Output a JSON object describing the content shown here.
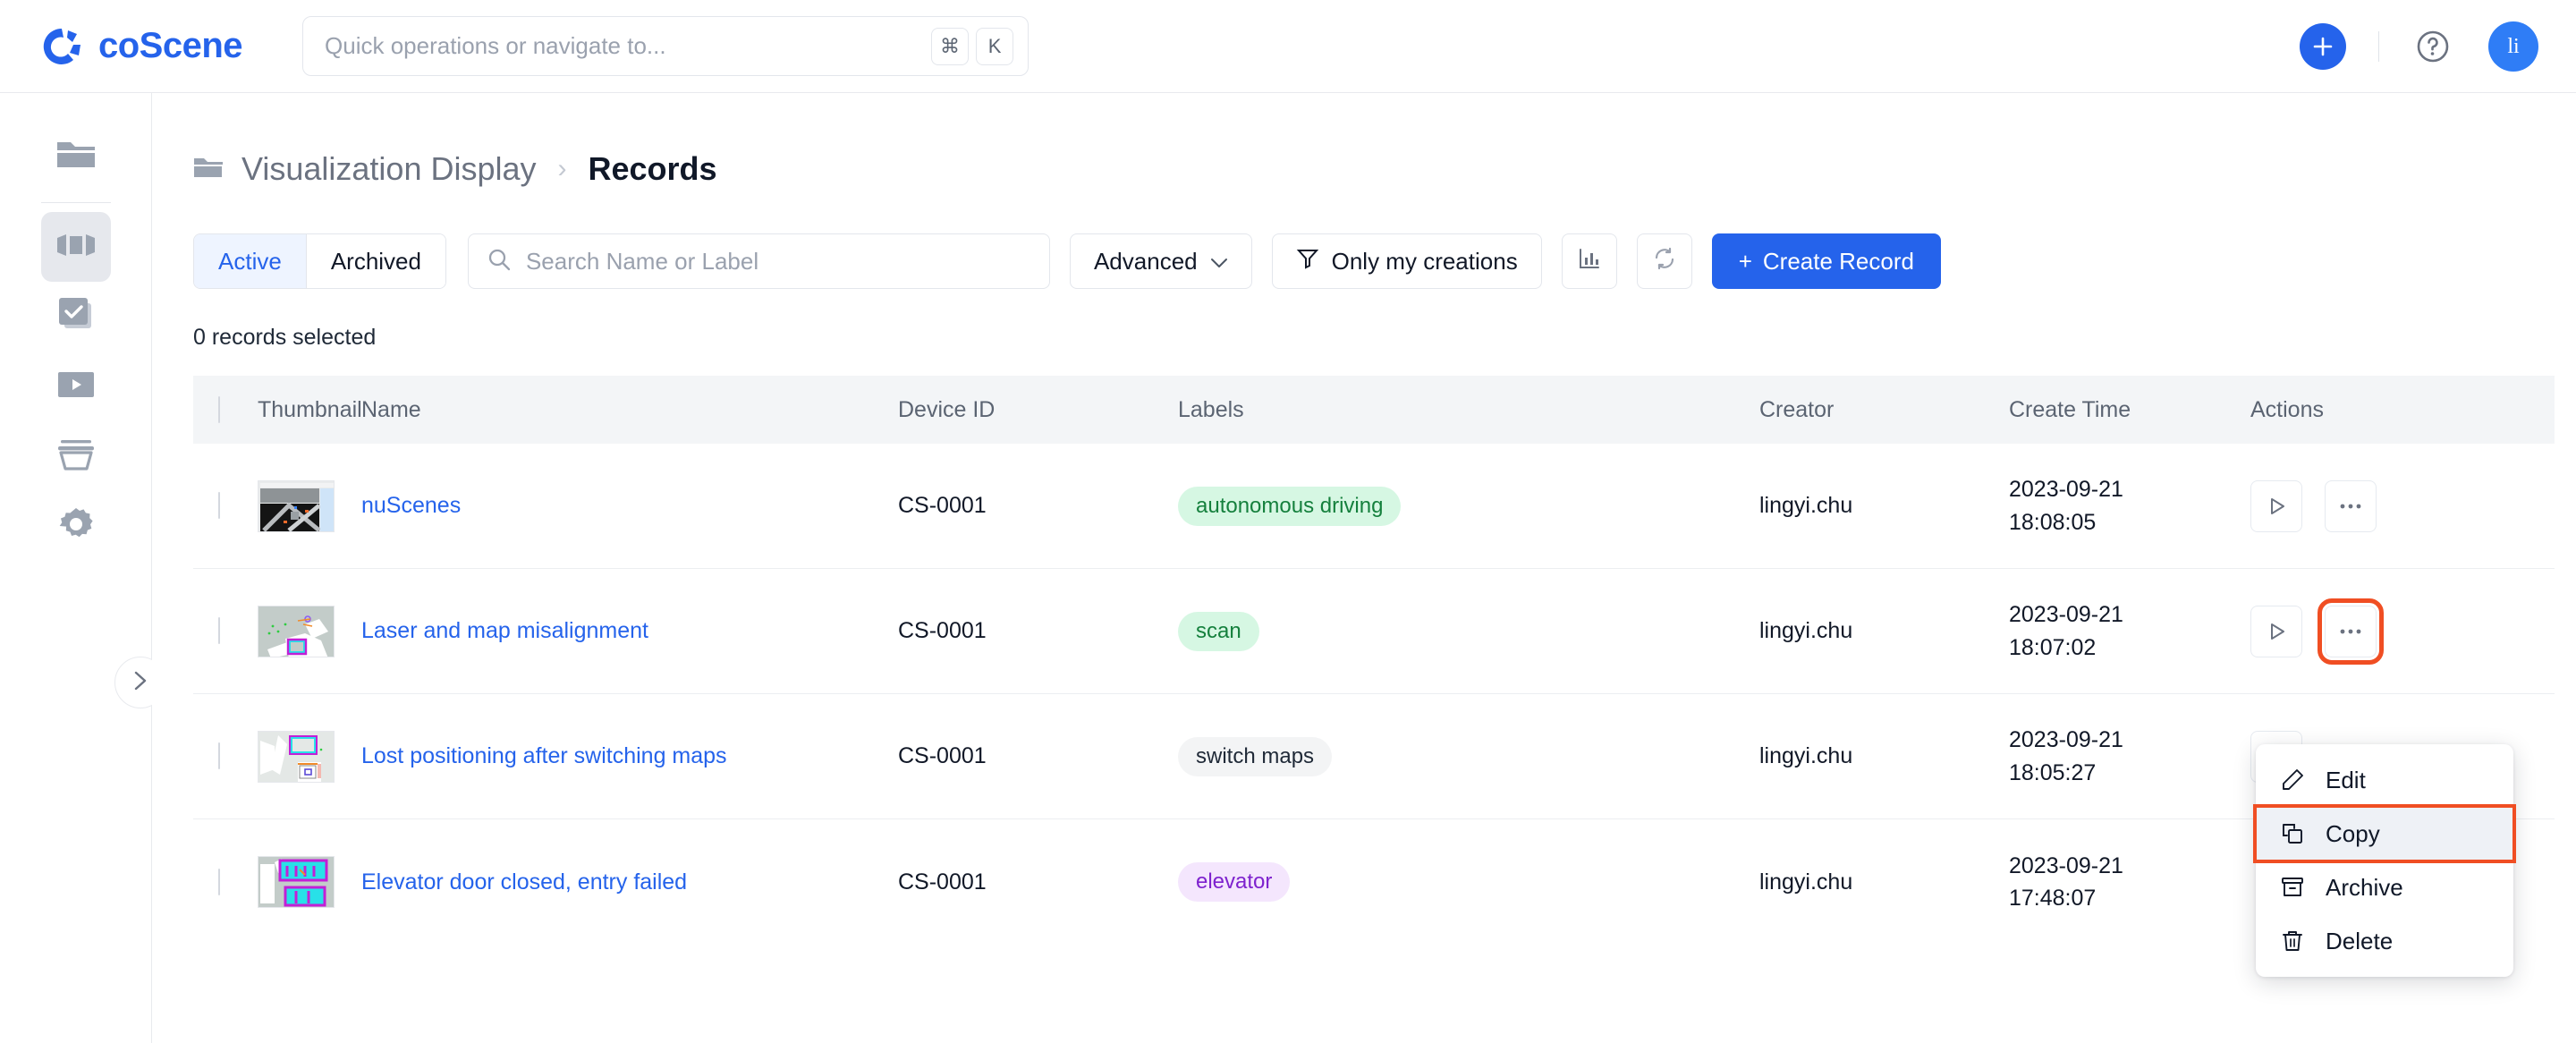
{
  "brand": {
    "name": "coScene"
  },
  "omnibox": {
    "placeholder": "Quick operations or navigate to...",
    "key1": "⌘",
    "key2": "K"
  },
  "topbar": {
    "add_label": "+",
    "avatar_initials": "li"
  },
  "breadcrumb": {
    "parent": "Visualization Display",
    "separator": "›",
    "current": "Records"
  },
  "toolbar": {
    "tab_active": "Active",
    "tab_archived": "Archived",
    "search_placeholder": "Search Name or Label",
    "advanced": "Advanced",
    "advanced_caret": "∨",
    "only_my_creations": "Only my creations",
    "create_record": "Create Record",
    "create_plus": "+"
  },
  "selection": {
    "count_text": "0 records selected"
  },
  "table": {
    "columns": [
      "Thumbnail",
      "Name",
      "Device ID",
      "Labels",
      "Creator",
      "Create Time",
      "Actions"
    ],
    "rows": [
      {
        "name": "nuScenes",
        "device_id": "CS-0001",
        "label": "autonomous driving",
        "label_color": "green",
        "creator": "lingyi.chu",
        "date": "2023-09-21",
        "time": "18:08:05",
        "thumb": "nuscenes"
      },
      {
        "name": "Laser and map misalignment",
        "device_id": "CS-0001",
        "label": "scan",
        "label_color": "green",
        "creator": "lingyi.chu",
        "date": "2023-09-21",
        "time": "18:07:02",
        "thumb": "map-scan"
      },
      {
        "name": "Lost positioning after switching maps",
        "device_id": "CS-0001",
        "label": "switch maps",
        "label_color": "gray",
        "creator": "lingyi.chu",
        "date": "2023-09-21",
        "time": "18:05:27",
        "thumb": "map-switch"
      },
      {
        "name": "Elevator door closed, entry failed",
        "device_id": "CS-0001",
        "label": "elevator",
        "label_color": "purple",
        "creator": "lingyi.chu",
        "date": "2023-09-21",
        "time": "17:48:07",
        "thumb": "map-elevator"
      }
    ]
  },
  "context_menu": {
    "items": [
      "Edit",
      "Copy",
      "Archive",
      "Delete"
    ],
    "selected": "Copy"
  },
  "colors": {
    "brand_blue": "#2563eb",
    "link_blue": "#2563eb",
    "highlight_orange": "#f04e23",
    "badge_green_bg": "#d6f7e3",
    "badge_green_fg": "#15803d",
    "badge_gray_bg": "#f3f4f5",
    "badge_purple_bg": "#f4e6fd",
    "badge_purple_fg": "#7e22ce",
    "header_row_bg": "#f3f5f7"
  }
}
